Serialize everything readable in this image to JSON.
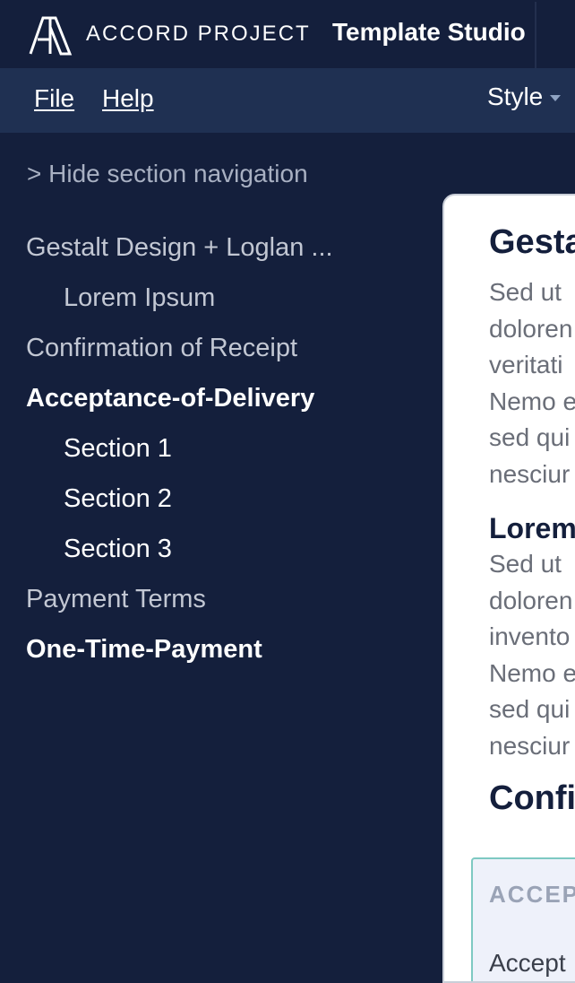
{
  "header": {
    "brand": "ACCORD PROJECT",
    "app_title": "Template Studio",
    "logo_icon": "accord-project-logo-icon"
  },
  "menubar": {
    "file_label": "File",
    "help_label": "Help",
    "style_label": "Style"
  },
  "sidebar": {
    "hide_label": "> Hide section navigation",
    "items": [
      {
        "label": "Gestalt Design + Loglan ...",
        "level": 0,
        "style": "muted"
      },
      {
        "label": "Lorem Ipsum",
        "level": 1,
        "style": "muted"
      },
      {
        "label": "Confirmation of Receipt",
        "level": 0,
        "style": "muted"
      },
      {
        "label": "Acceptance-of-Delivery",
        "level": 0,
        "style": "bold"
      },
      {
        "label": "Section 1",
        "level": 1,
        "style": "bright"
      },
      {
        "label": "Section 2",
        "level": 1,
        "style": "bright"
      },
      {
        "label": "Section 3",
        "level": 1,
        "style": "bright"
      },
      {
        "label": "Payment Terms",
        "level": 0,
        "style": "muted"
      },
      {
        "label": "One-Time-Payment",
        "level": 0,
        "style": "bold"
      }
    ]
  },
  "document": {
    "heading1": "Gesta",
    "para1": [
      "Sed ut",
      "doloren",
      "veritati",
      "Nemo e",
      "sed qui",
      "nesciur"
    ],
    "heading2": "Lorem",
    "para2": [
      "Sed ut",
      "doloren",
      "invento",
      "Nemo e",
      "sed qui",
      "nesciur"
    ],
    "heading3": "Confi",
    "callout_head": "ACCEPT",
    "callout_body": "Accept"
  },
  "colors": {
    "background": "#141f3c",
    "menubar": "#1f3052",
    "callout_border": "#7ec9c2"
  }
}
